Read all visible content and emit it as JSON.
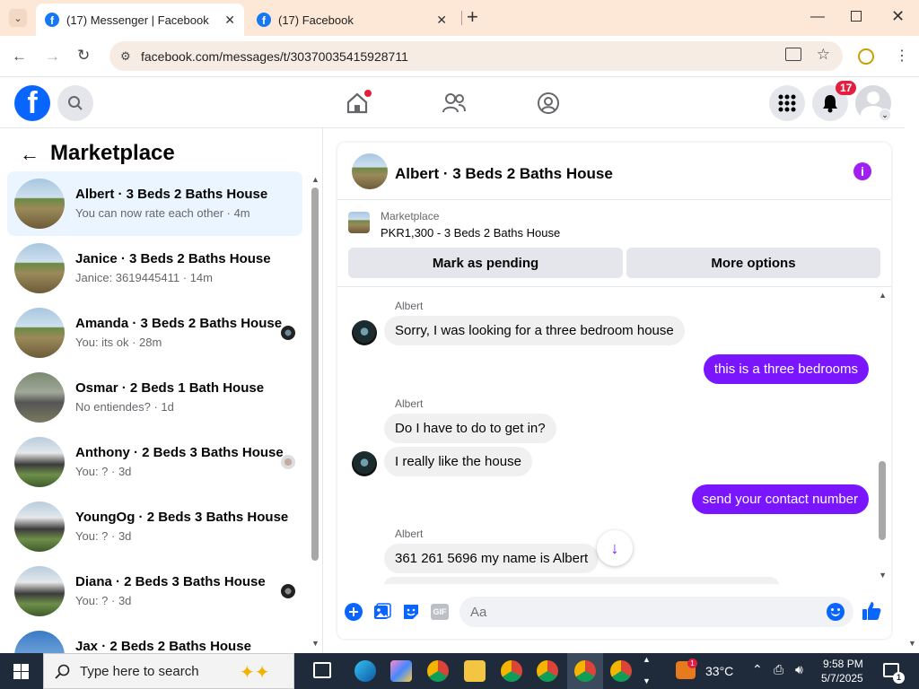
{
  "browser": {
    "tabs": [
      {
        "label": "(17) Messenger | Facebook",
        "active": true
      },
      {
        "label": "(17) Facebook",
        "active": false
      }
    ],
    "new_tab": "+",
    "url": "facebook.com/messages/t/30370035415928711"
  },
  "fb": {
    "notif_count": "17"
  },
  "marketplace": {
    "title": "Marketplace",
    "conversations": [
      {
        "name": "Albert · 3 Beds 2 Baths House",
        "snippet": "You can now rate each other · 4m",
        "thumb": "house"
      },
      {
        "name": "Janice · 3 Beds 2 Baths House",
        "snippet": "Janice: 3619445411 · 14m",
        "thumb": "house"
      },
      {
        "name": "Amanda · 3 Beds 2 Baths House",
        "snippet": "You: its ok · 28m",
        "thumb": "house"
      },
      {
        "name": "Osmar · 2 Beds 1 Bath House",
        "snippet": "No entiendes? · 1d",
        "thumb": "house3"
      },
      {
        "name": "Anthony · 2 Beds 3 Baths House",
        "snippet": "You: ? · 3d",
        "thumb": "house2"
      },
      {
        "name": "YoungOg · 2 Beds 3 Baths House",
        "snippet": "You: ? · 3d",
        "thumb": "house2"
      },
      {
        "name": "Diana · 2 Beds 3 Baths House",
        "snippet": "You: ? · 3d",
        "thumb": "house2"
      },
      {
        "name": "Jax · 2 Beds 2 Baths House",
        "snippet": "",
        "thumb": "house4"
      }
    ]
  },
  "chat": {
    "title": "Albert · 3 Beds 2 Baths House",
    "listing_category": "Marketplace",
    "listing_price": "PKR1,300 - 3 Beds 2 Baths House",
    "mark_pending": "Mark as pending",
    "more_options": "More options",
    "messages": [
      {
        "sender": "Albert",
        "text": "Sorry, I was looking for a three bedroom house",
        "dir": "in"
      },
      {
        "text": "this is a three bedrooms",
        "dir": "out"
      },
      {
        "sender": "Albert",
        "text": "Do I have to do to get in?",
        "dir": "in"
      },
      {
        "text": "I really like the house",
        "dir": "in"
      },
      {
        "text": "send your contact number",
        "dir": "out"
      },
      {
        "sender": "Albert",
        "text": "361 261 5696 my name is Albert",
        "dir": "in"
      }
    ],
    "composer_placeholder": "Aa"
  },
  "taskbar": {
    "search_placeholder": "Type here to search",
    "temperature": "33°C",
    "time": "9:58 PM",
    "date": "5/7/2025",
    "notif": "1"
  }
}
